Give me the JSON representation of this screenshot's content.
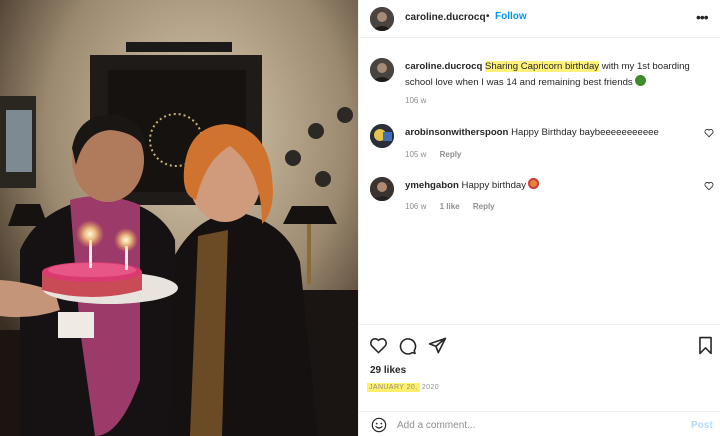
{
  "post": {
    "username": "caroline.ducrocq",
    "separator": "•",
    "follow_label": "Follow",
    "more_icon": "more-horizontal-icon"
  },
  "caption": {
    "username": "caroline.ducrocq",
    "highlighted": "Sharing Capricorn birthday",
    "text": " with my 1st boarding school love when I was 14 and remaining best friends",
    "age": "106 w"
  },
  "comments": [
    {
      "username": "arobinsonwitherspoon",
      "text": "Happy Birthday baybeeeeeeeeeee",
      "age": "105 w",
      "likes": "",
      "reply_label": "Reply"
    },
    {
      "username": "ymehgabon",
      "text": "Happy birthday",
      "age": "106 w",
      "likes": "1 like",
      "reply_label": "Reply"
    }
  ],
  "actions": {
    "icons": [
      "heart-icon",
      "comment-icon",
      "share-icon",
      "bookmark-icon"
    ],
    "likes_text": "29 likes",
    "date_highlighted": "JANUARY 20,",
    "date_rest": " 2020"
  },
  "comment_box": {
    "placeholder": "Add a comment...",
    "post_label": "Post"
  },
  "colors": {
    "link": "#0095f6",
    "highlight": "#fff27a",
    "muted": "#8e8e8e",
    "post_disabled": "#b3dbff"
  }
}
